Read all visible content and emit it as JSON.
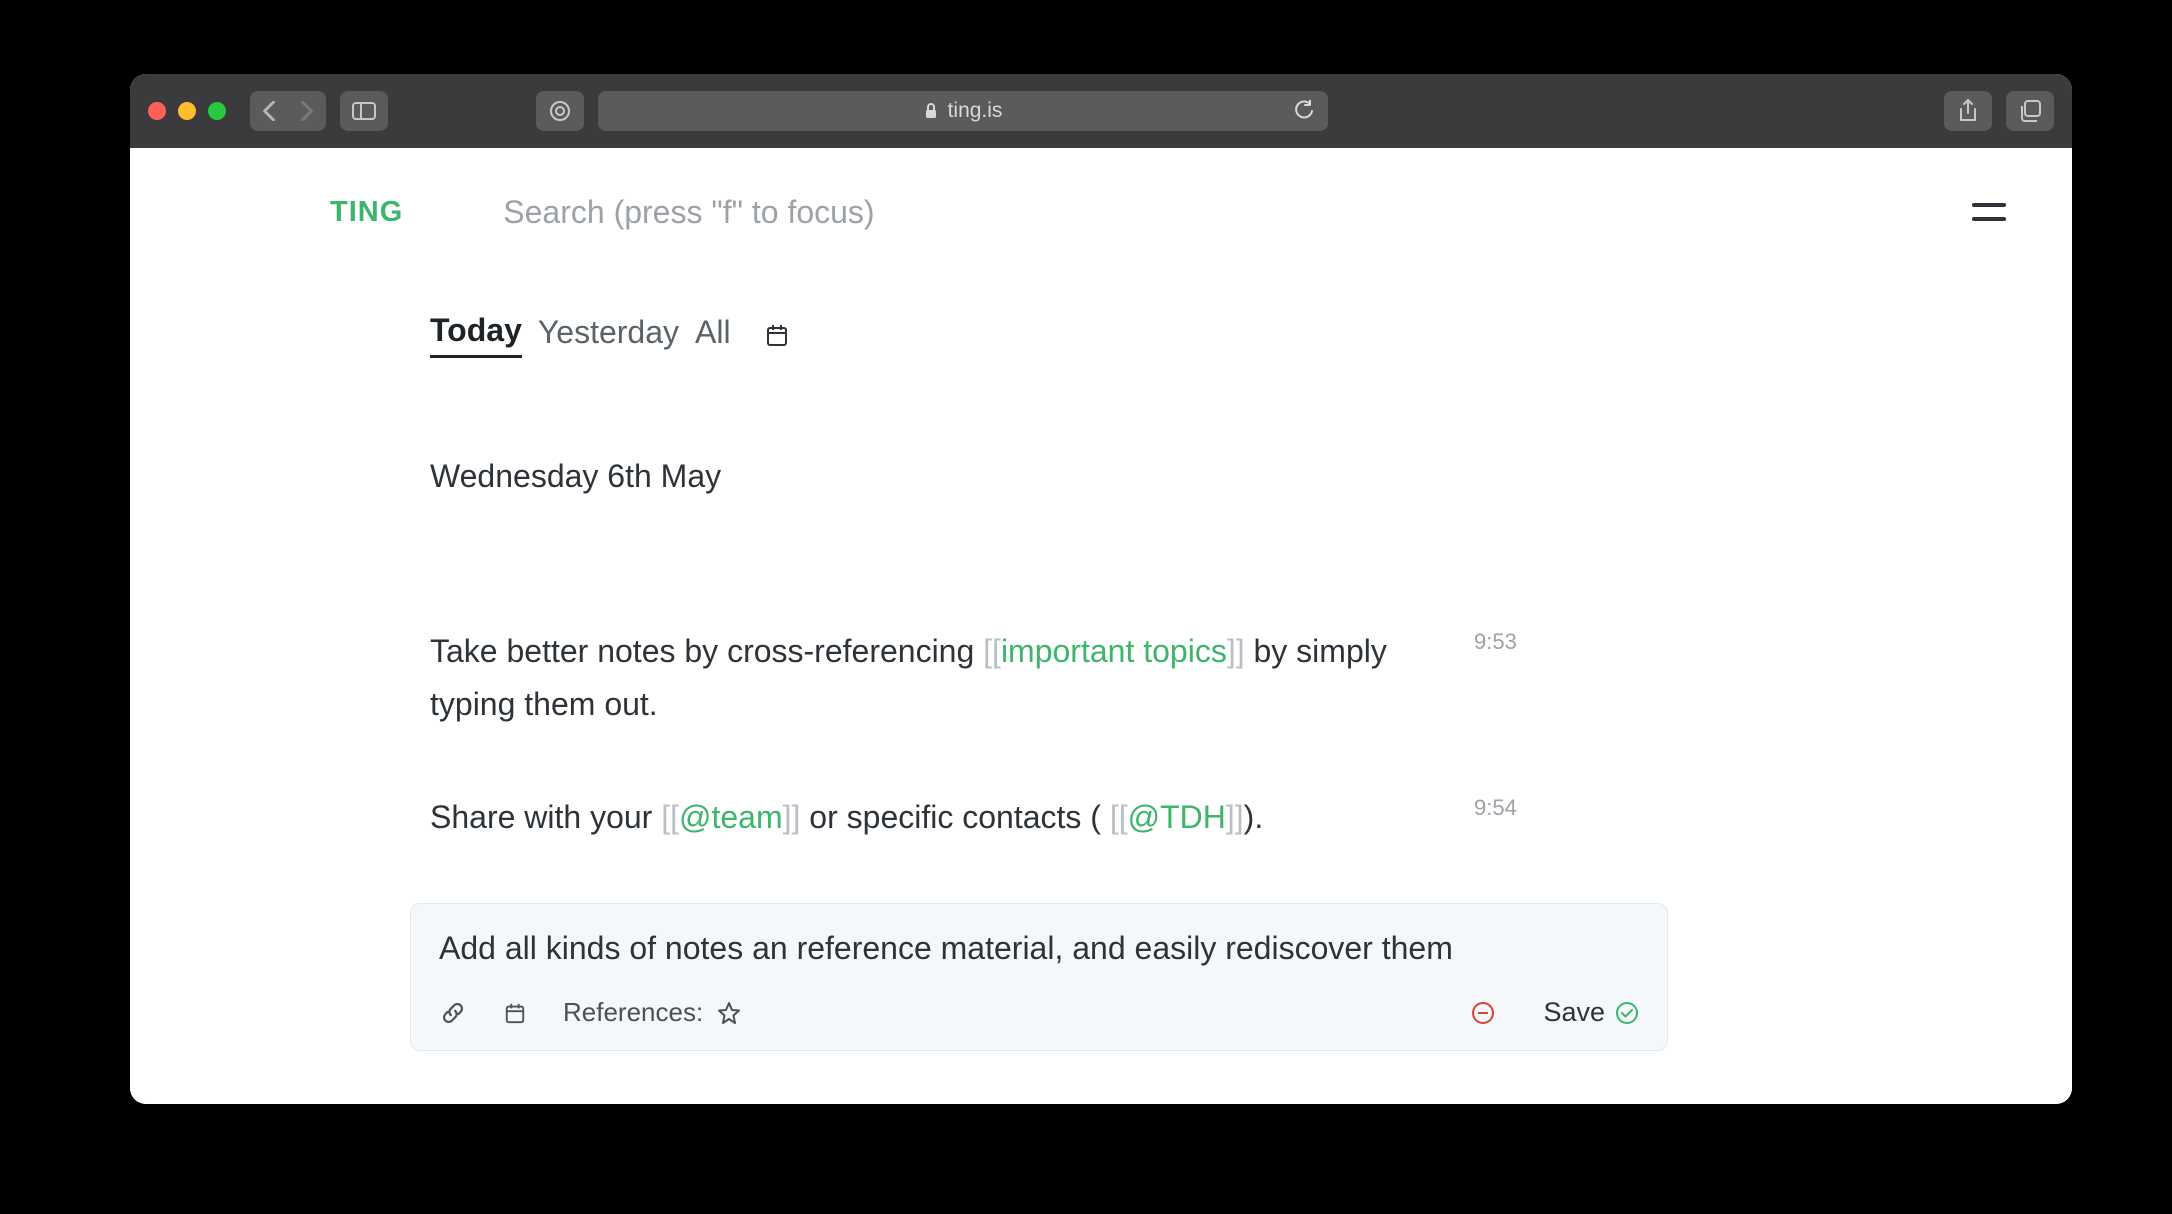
{
  "browser": {
    "url_host": "ting.is"
  },
  "header": {
    "brand": "TING",
    "search_placeholder": "Search (press \"f\" to focus)"
  },
  "tabs": {
    "today": "Today",
    "yesterday": "Yesterday",
    "all": "All"
  },
  "date_heading": "Wednesday 6th May",
  "notes": [
    {
      "time": "9:53",
      "parts": {
        "pre": "Take better notes by cross-referencing ",
        "bl": "[[",
        "link": "important topics",
        "br": "]]",
        "post": " by simply typing them out."
      }
    },
    {
      "time": "9:54",
      "parts": {
        "pre": "Share with your ",
        "bl1": "[[",
        "link1": "@team",
        "br1": "]]",
        "mid": " or specific contacts ( ",
        "bl2": "[[",
        "link2": "@TDH",
        "br2": "]]",
        "post": ")."
      }
    }
  ],
  "editor": {
    "text": "Add all kinds of notes an reference material, and easily rediscover them",
    "references_label": "References:",
    "save_label": "Save"
  }
}
